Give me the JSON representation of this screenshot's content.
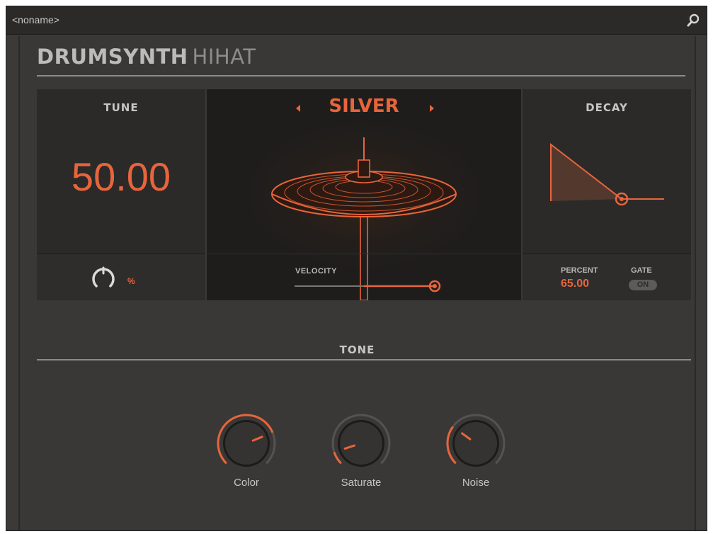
{
  "titlebar": {
    "preset_name": "<noname>",
    "search_icon": "search-icon"
  },
  "header": {
    "brand": "DRUMSYNTH",
    "model": "HIHAT"
  },
  "tune": {
    "title": "TUNE",
    "value": "50.00",
    "unit": "%",
    "knob_level": 0.5
  },
  "visual": {
    "sound_name": "SILVER",
    "prev_icon": "triangle-left-icon",
    "next_icon": "triangle-right-icon",
    "velocity_label": "VELOCITY",
    "velocity_level": 1.0
  },
  "decay": {
    "title": "DECAY",
    "percent_label": "PERCENT",
    "percent_value": "65.00",
    "gate_label": "GATE",
    "gate_value": "ON"
  },
  "tone": {
    "title": "TONE",
    "knobs": [
      {
        "label": "Color",
        "level": 0.75
      },
      {
        "label": "Saturate",
        "level": 0.1
      },
      {
        "label": "Noise",
        "level": 0.3
      }
    ]
  },
  "colors": {
    "accent": "#e7653c",
    "panel_bg": "#393837",
    "dark_bg": "#2b2a29",
    "text": "#c8c6c2"
  }
}
